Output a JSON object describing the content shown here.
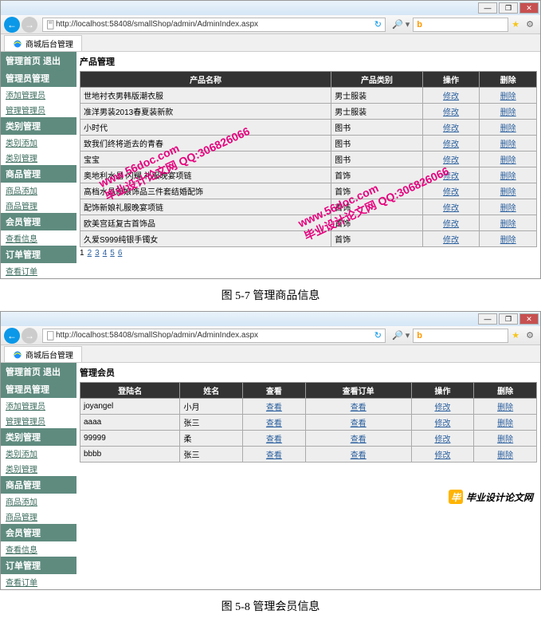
{
  "browser": {
    "url": "http://localhost:58408/smallShop/admin/AdminIndex.aspx",
    "tab_title": "商城后台管理",
    "search_hint_icon": "search"
  },
  "sidebar": {
    "header": "管理首页  退出",
    "sections": [
      {
        "title": "管理员管理",
        "links": [
          "添加管理员",
          "管理管理员"
        ]
      },
      {
        "title": "类别管理",
        "links": [
          "类别添加",
          "类别管理"
        ]
      },
      {
        "title": "商品管理",
        "links": [
          "商品添加",
          "商品管理"
        ]
      },
      {
        "title": "会员管理",
        "links": [
          "查看信息"
        ]
      },
      {
        "title": "订单管理",
        "links": [
          "查看订单"
        ]
      }
    ]
  },
  "screen1": {
    "title": "产品管理",
    "columns": [
      "产品名称",
      "产品类别",
      "操作",
      "删除"
    ],
    "rows": [
      {
        "name": "世地衬衣男韩版潮衣服",
        "cat": "男士服装",
        "op": "修改",
        "del": "删除"
      },
      {
        "name": "准洋男装2013春夏装新款",
        "cat": "男士服装",
        "op": "修改",
        "del": "删除"
      },
      {
        "name": "小时代",
        "cat": "图书",
        "op": "修改",
        "del": "删除"
      },
      {
        "name": "致我们终将逝去的青春",
        "cat": "图书",
        "op": "修改",
        "del": "删除"
      },
      {
        "name": "宝宝",
        "cat": "图书",
        "op": "修改",
        "del": "删除"
      },
      {
        "name": "奥地利水晶 闪耀 礼服晚宴项链",
        "cat": "首饰",
        "op": "修改",
        "del": "删除"
      },
      {
        "name": "高档水晶新娘饰品三件套结婚配饰",
        "cat": "首饰",
        "op": "修改",
        "del": "删除"
      },
      {
        "name": "配饰新娘礼服晚宴项链",
        "cat": "首饰",
        "op": "修改",
        "del": "删除"
      },
      {
        "name": "欧美宫廷复古首饰品",
        "cat": "首饰",
        "op": "修改",
        "del": "删除"
      },
      {
        "name": "久爱S999纯银手镯女",
        "cat": "首饰",
        "op": "修改",
        "del": "删除"
      }
    ],
    "pager": [
      "1",
      "2",
      "3",
      "4",
      "5",
      "6"
    ]
  },
  "caption1": "图 5-7  管理商品信息",
  "screen2": {
    "title": "管理会员",
    "columns": [
      "登陆名",
      "姓名",
      "查看",
      "查看订单",
      "操作",
      "删除"
    ],
    "rows": [
      {
        "login": "joyangel",
        "name": "小月",
        "view": "查看",
        "order": "查看",
        "op": "修改",
        "del": "删除"
      },
      {
        "login": "aaaa",
        "name": "张三",
        "view": "查看",
        "order": "查看",
        "op": "修改",
        "del": "删除"
      },
      {
        "login": "99999",
        "name": "柔",
        "view": "查看",
        "order": "查看",
        "op": "修改",
        "del": "删除"
      },
      {
        "login": "bbbb",
        "name": "张三",
        "view": "查看",
        "order": "查看",
        "op": "修改",
        "del": "删除"
      }
    ]
  },
  "caption2": "图 5-8   管理会员信息",
  "watermarks": {
    "url": "www.56doc.com",
    "text": "毕业设计论文网",
    "qq": "QQ:306826066"
  },
  "footer": {
    "text": "毕业设计论文网"
  }
}
